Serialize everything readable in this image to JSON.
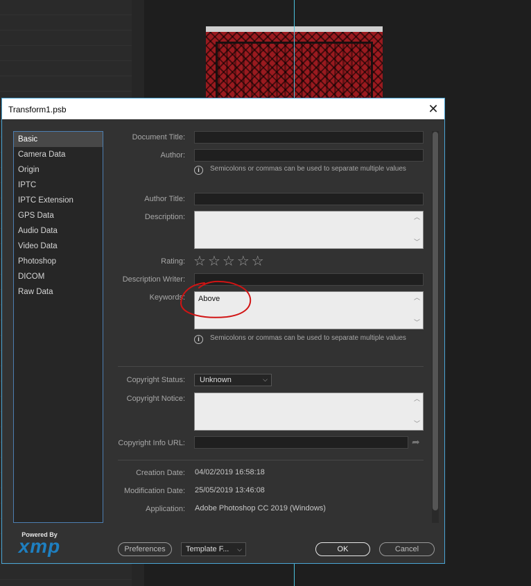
{
  "dialog": {
    "title": "Transform1.psb",
    "close_glyph": "✕"
  },
  "sidebar": {
    "items": [
      {
        "label": "Basic",
        "selected": true
      },
      {
        "label": "Camera Data"
      },
      {
        "label": "Origin"
      },
      {
        "label": "IPTC"
      },
      {
        "label": "IPTC Extension"
      },
      {
        "label": "GPS Data"
      },
      {
        "label": "Audio Data"
      },
      {
        "label": "Video Data"
      },
      {
        "label": "Photoshop"
      },
      {
        "label": "DICOM"
      },
      {
        "label": "Raw Data"
      }
    ]
  },
  "logo": {
    "powered_by": "Powered By",
    "word": "xmp",
    "color": "#1e7fc0"
  },
  "form": {
    "document_title": {
      "label": "Document Title:",
      "value": ""
    },
    "author": {
      "label": "Author:",
      "value": ""
    },
    "hint_author": "Semicolons or commas can be used to separate multiple values",
    "author_title": {
      "label": "Author Title:",
      "value": ""
    },
    "description": {
      "label": "Description:",
      "value": ""
    },
    "rating": {
      "label": "Rating:",
      "value": 0,
      "max": 5,
      "star_glyph": "☆"
    },
    "description_writer": {
      "label": "Description Writer:",
      "value": ""
    },
    "keywords": {
      "label": "Keywords:",
      "value": "Above"
    },
    "hint_keywords": "Semicolons or commas can be used to separate multiple values",
    "copyright_status": {
      "label": "Copyright Status:",
      "value": "Unknown"
    },
    "copyright_notice": {
      "label": "Copyright Notice:",
      "value": ""
    },
    "copyright_url": {
      "label": "Copyright Info URL:",
      "value": ""
    },
    "creation_date": {
      "label": "Creation Date:",
      "value": "04/02/2019 16:58:18"
    },
    "modification_date": {
      "label": "Modification Date:",
      "value": "25/05/2019 13:46:08"
    },
    "application": {
      "label": "Application:",
      "value": "Adobe Photoshop CC 2019 (Windows)"
    }
  },
  "buttons": {
    "preferences": "Preferences",
    "template": "Template F...",
    "ok": "OK",
    "cancel": "Cancel"
  },
  "icons": {
    "info": "i",
    "caret": "⌵",
    "scroll_up": "︿",
    "scroll_down": "﹀",
    "share": "➦"
  },
  "annotation": {
    "color": "#d11414"
  }
}
